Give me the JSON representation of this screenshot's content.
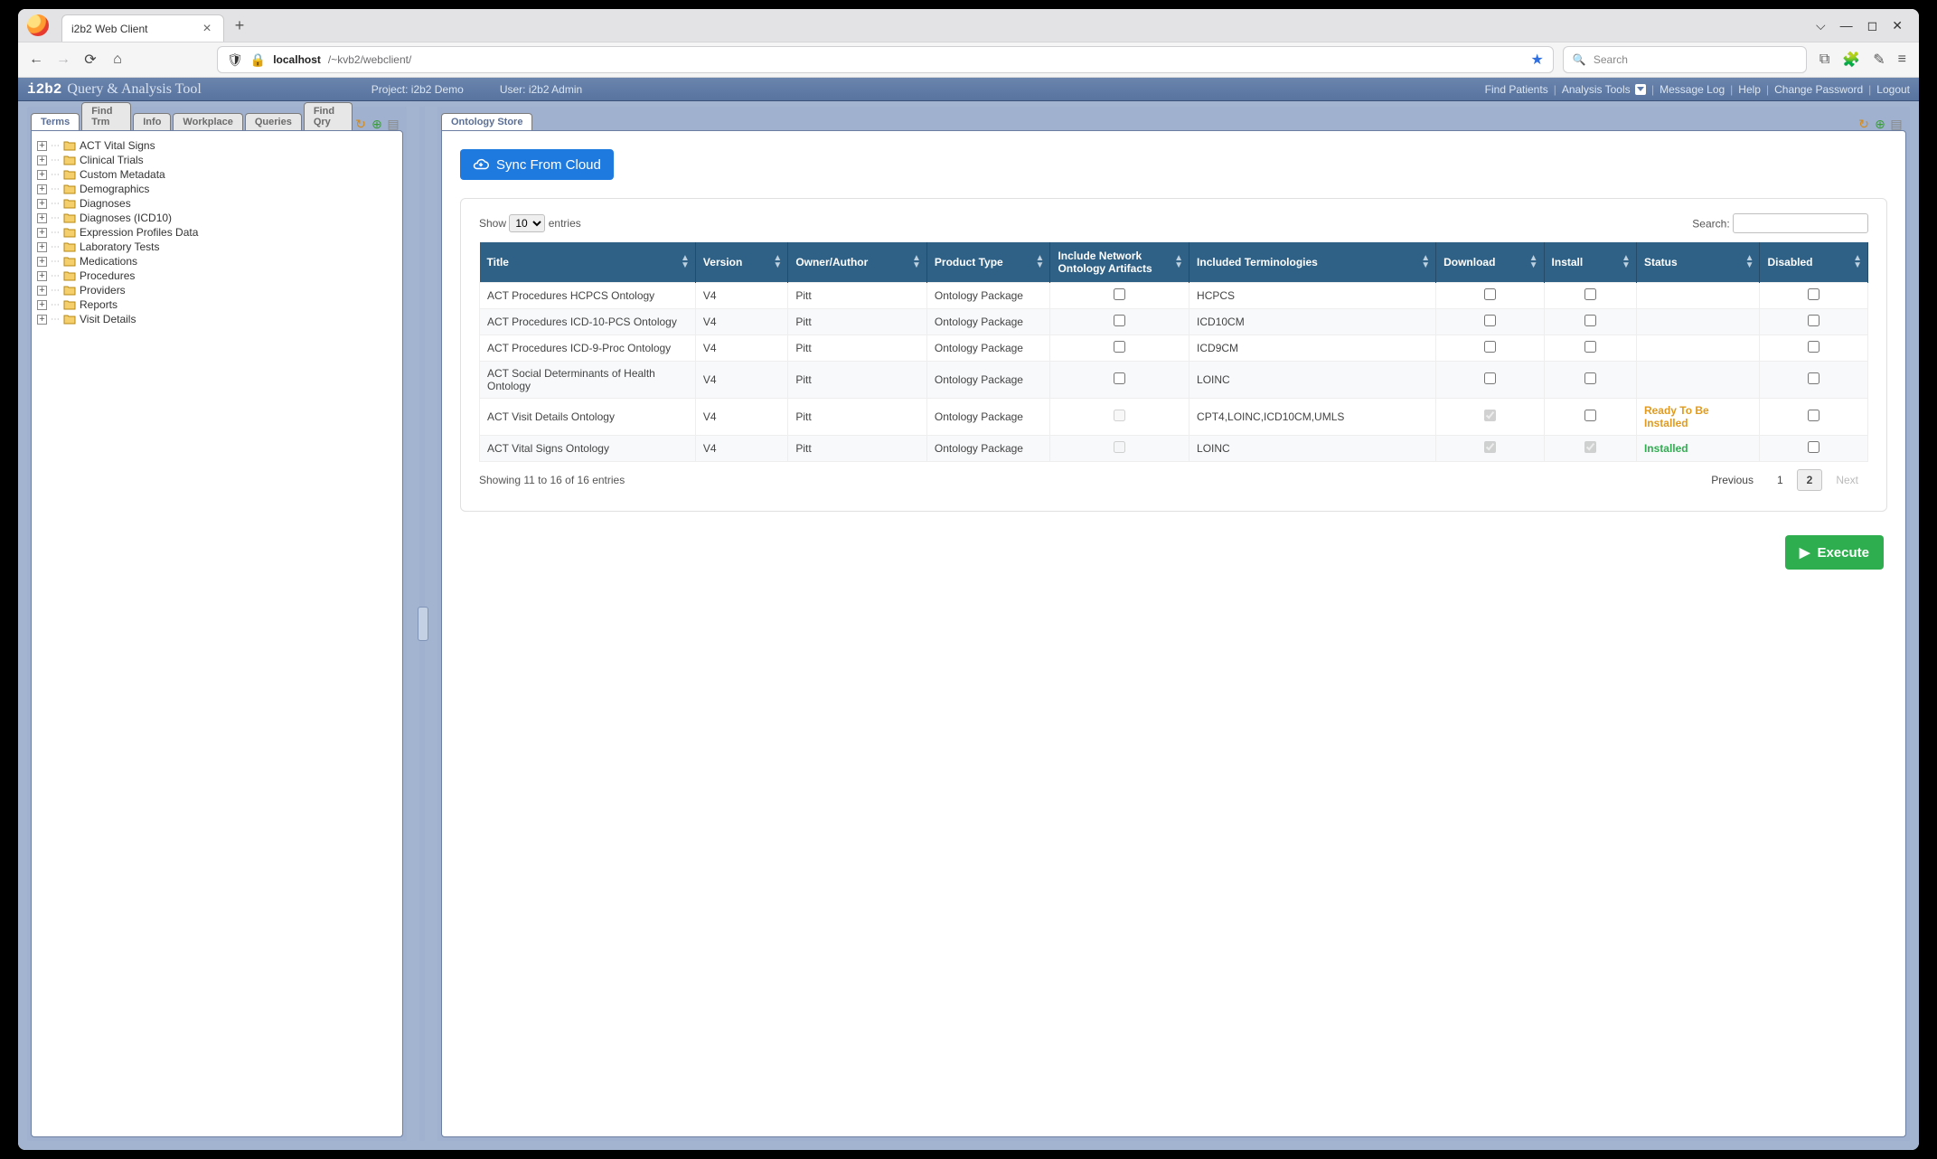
{
  "browser": {
    "tab_title": "i2b2 Web Client",
    "url_host": "localhost",
    "url_path": "/~kvb2/webclient/",
    "search_placeholder": "Search",
    "chevron_down": "⌵"
  },
  "app_header": {
    "brand_code": "i2b2",
    "brand_title": "Query & Analysis Tool",
    "project_label": "Project: i2b2 Demo",
    "user_label": "User: i2b2 Admin",
    "links": {
      "find_patients": "Find Patients",
      "analysis_tools": "Analysis Tools",
      "message_log": "Message Log",
      "help": "Help",
      "change_password": "Change Password",
      "logout": "Logout"
    }
  },
  "left_panel": {
    "tabs": [
      "Terms",
      "Find Trm",
      "Info",
      "Workplace",
      "Queries",
      "Find Qry"
    ],
    "active_tab": "Terms",
    "tree": [
      "ACT Vital Signs",
      "Clinical Trials",
      "Custom Metadata",
      "Demographics",
      "Diagnoses",
      "Diagnoses (ICD10)",
      "Expression Profiles Data",
      "Laboratory Tests",
      "Medications",
      "Procedures",
      "Providers",
      "Reports",
      "Visit Details"
    ]
  },
  "right_panel": {
    "tab": "Ontology Store",
    "sync_button": "Sync From Cloud",
    "datatable": {
      "show_label_pre": "Show",
      "show_label_post": "entries",
      "page_size": "10",
      "search_label": "Search:",
      "columns": [
        "Title",
        "Version",
        "Owner/Author",
        "Product Type",
        "Include Network Ontology Artifacts",
        "Included Terminologies",
        "Download",
        "Install",
        "Status",
        "Disabled"
      ],
      "rows": [
        {
          "title": "ACT Procedures HCPCS Ontology",
          "version": "V4",
          "owner": "Pitt",
          "ptype": "Ontology Package",
          "net": {
            "checked": false,
            "disabled": false
          },
          "terms": "HCPCS",
          "download": {
            "checked": false,
            "disabled": false
          },
          "install": {
            "checked": false,
            "disabled": false
          },
          "status": "",
          "status_class": "",
          "disabled": {
            "checked": false,
            "disabled": false
          }
        },
        {
          "title": "ACT Procedures ICD-10-PCS Ontology",
          "version": "V4",
          "owner": "Pitt",
          "ptype": "Ontology Package",
          "net": {
            "checked": false,
            "disabled": false
          },
          "terms": "ICD10CM",
          "download": {
            "checked": false,
            "disabled": false
          },
          "install": {
            "checked": false,
            "disabled": false
          },
          "status": "",
          "status_class": "",
          "disabled": {
            "checked": false,
            "disabled": false
          }
        },
        {
          "title": "ACT Procedures ICD-9-Proc Ontology",
          "version": "V4",
          "owner": "Pitt",
          "ptype": "Ontology Package",
          "net": {
            "checked": false,
            "disabled": false
          },
          "terms": "ICD9CM",
          "download": {
            "checked": false,
            "disabled": false
          },
          "install": {
            "checked": false,
            "disabled": false
          },
          "status": "",
          "status_class": "",
          "disabled": {
            "checked": false,
            "disabled": false
          }
        },
        {
          "title": "ACT Social Determinants of Health Ontology",
          "version": "V4",
          "owner": "Pitt",
          "ptype": "Ontology Package",
          "net": {
            "checked": false,
            "disabled": false
          },
          "terms": "LOINC",
          "download": {
            "checked": false,
            "disabled": false
          },
          "install": {
            "checked": false,
            "disabled": false
          },
          "status": "",
          "status_class": "",
          "disabled": {
            "checked": false,
            "disabled": false
          }
        },
        {
          "title": "ACT Visit Details Ontology",
          "version": "V4",
          "owner": "Pitt",
          "ptype": "Ontology Package",
          "net": {
            "checked": false,
            "disabled": true
          },
          "terms": "CPT4,LOINC,ICD10CM,UMLS",
          "download": {
            "checked": true,
            "disabled": true
          },
          "install": {
            "checked": false,
            "disabled": false
          },
          "status": "Ready To Be Installed",
          "status_class": "status-ready",
          "disabled": {
            "checked": false,
            "disabled": false
          }
        },
        {
          "title": "ACT Vital Signs Ontology",
          "version": "V4",
          "owner": "Pitt",
          "ptype": "Ontology Package",
          "net": {
            "checked": false,
            "disabled": true
          },
          "terms": "LOINC",
          "download": {
            "checked": true,
            "disabled": true
          },
          "install": {
            "checked": true,
            "disabled": true
          },
          "status": "Installed",
          "status_class": "status-installed",
          "disabled": {
            "checked": false,
            "disabled": false
          }
        }
      ],
      "info": "Showing 11 to 16 of 16 entries",
      "pager": {
        "prev": "Previous",
        "next": "Next",
        "pages": [
          "1",
          "2"
        ],
        "active": "2"
      }
    },
    "execute_button": "Execute"
  }
}
